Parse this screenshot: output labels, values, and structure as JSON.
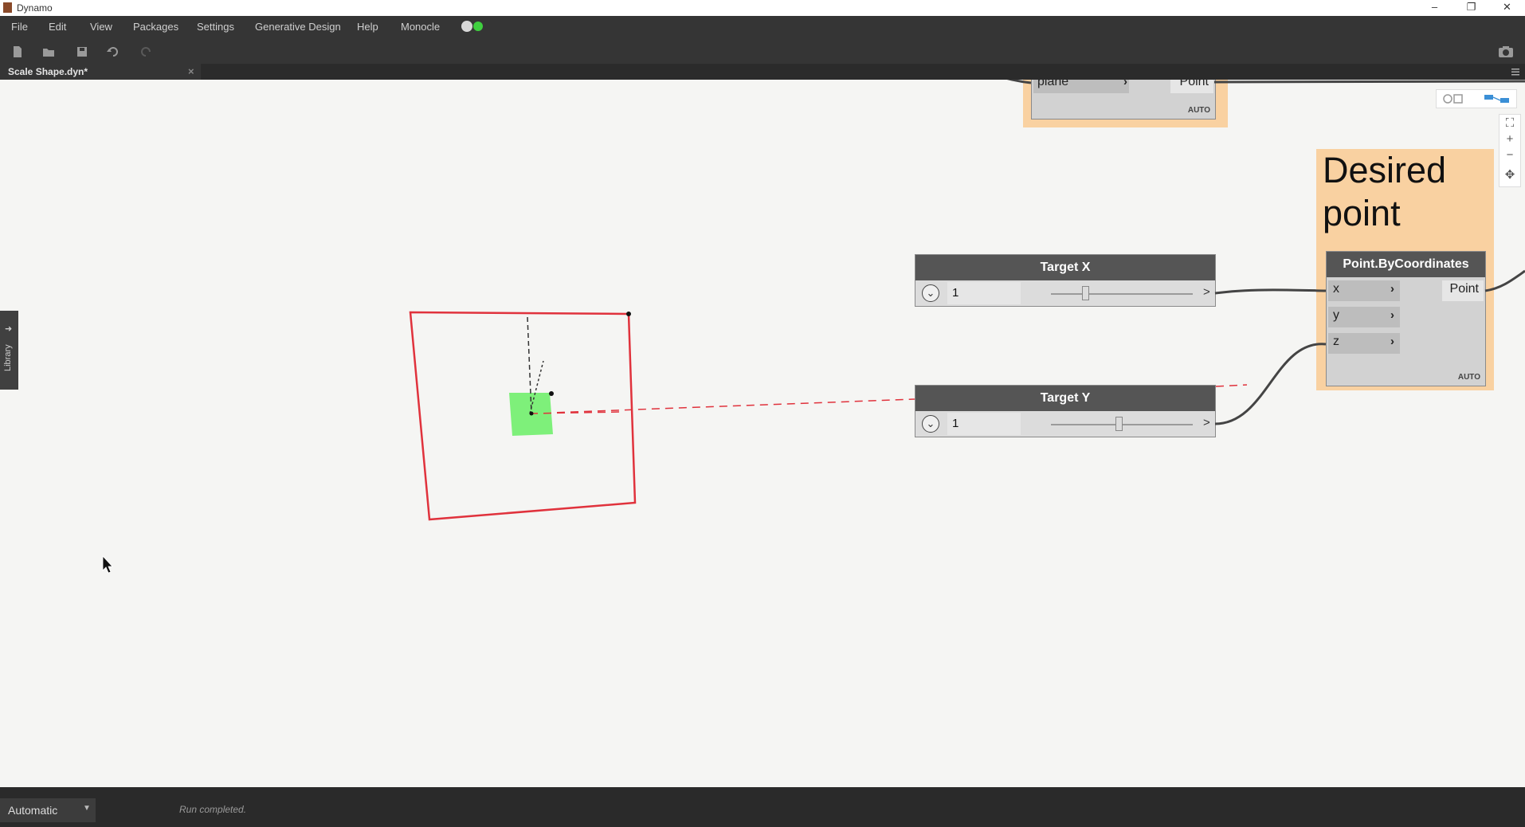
{
  "window": {
    "title": "Dynamo",
    "minimize": "–",
    "restore": "❐",
    "close": "✕"
  },
  "menu": [
    "File",
    "Edit",
    "View",
    "Packages",
    "Settings",
    "Generative Design",
    "Help",
    "Monocle"
  ],
  "toolbar": {
    "icons": [
      "new-file-icon",
      "open-file-icon",
      "save-icon",
      "undo-icon",
      "redo-icon",
      "camera-icon"
    ]
  },
  "tab": {
    "label": "Scale Shape.dyn*",
    "close": "×"
  },
  "library": {
    "label": "Library"
  },
  "groups": {
    "desired_point": "Desired point"
  },
  "nodes": {
    "top_node": {
      "input_label": "plane",
      "output_label": "Point",
      "lacing": "AUTO"
    },
    "target_x": {
      "title": "Target X",
      "value": "1",
      "level": 0.24,
      "expand": ">"
    },
    "target_y": {
      "title": "Target Y",
      "value": "1",
      "level": 0.48,
      "expand": ">"
    },
    "point_by_coordinates": {
      "title": "Point.ByCoordinates",
      "inputs": [
        "x",
        "y",
        "z"
      ],
      "output": "Point",
      "lacing": "AUTO"
    }
  },
  "statusbar": {
    "run_mode": "Automatic",
    "status": "Run completed."
  },
  "colors": {
    "group_fill": "#f9d1a1",
    "node_header": "#555555",
    "geometry_red": "#e0323c",
    "geometry_green": "#7ef07a"
  }
}
